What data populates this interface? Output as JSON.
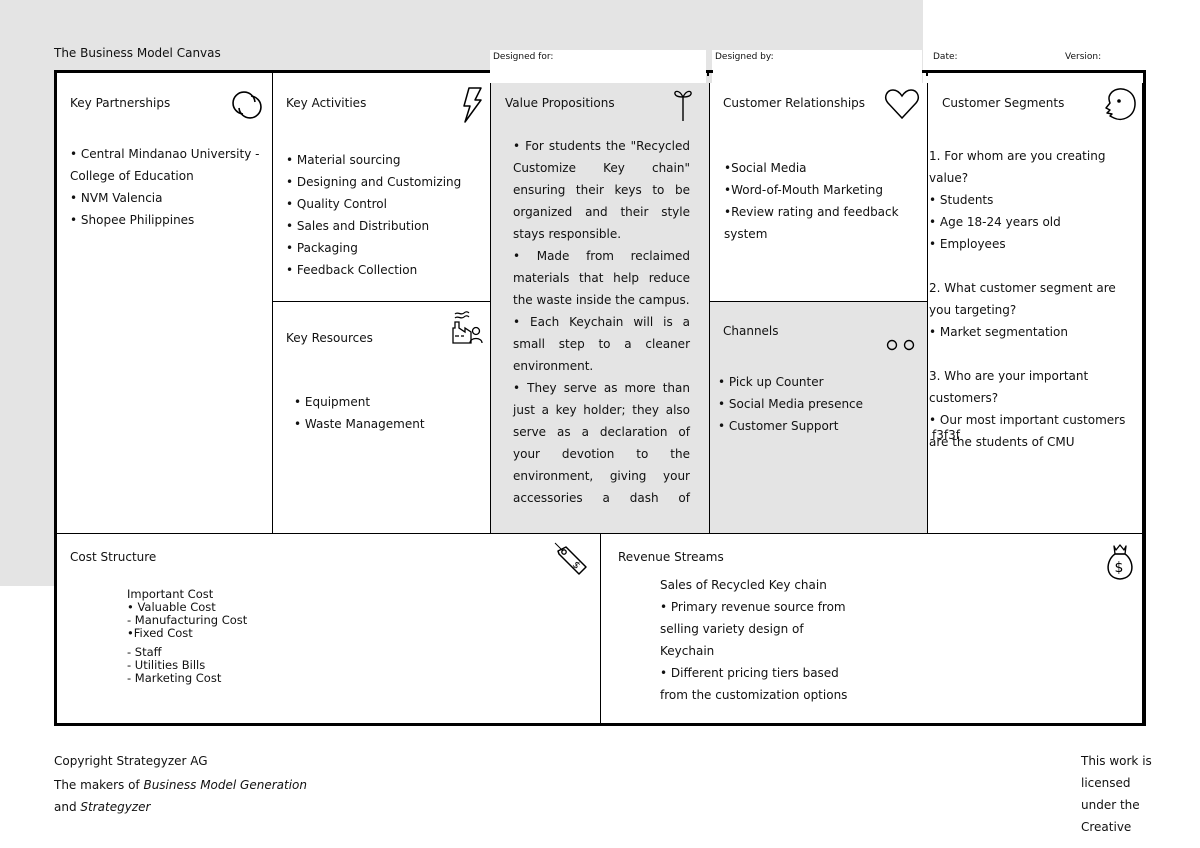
{
  "header": {
    "title": "The Business Model Canvas",
    "designed_for_label": "Designed for:",
    "designed_by_label": "Designed by:",
    "date_label": "Date:",
    "version_label": "Version:"
  },
  "blocks": {
    "key_partnerships": {
      "title": "Key Partnerships",
      "icon": "link-icon",
      "items": [
        "• Central Mindanao University -",
        "College of Education",
        "• NVM Valencia",
        "• Shopee Philippines"
      ]
    },
    "key_activities": {
      "title": "Key Activities",
      "icon": "lightning-icon",
      "items": [
        "• Material sourcing",
        "• Designing and Customizing",
        "• Quality Control",
        "• Sales and Distribution",
        "• Packaging",
        "• Feedback Collection"
      ]
    },
    "key_resources": {
      "title": "Key Resources",
      "icon": "factory-worker-icon",
      "items": [
        "• Equipment",
        "• Waste Management"
      ]
    },
    "value_propositions": {
      "title": "Value Propositions",
      "icon": "gift-icon",
      "text": "• For students the \"Recycled Customize Key chain\" ensuring their keys to be organized and their style stays responsible. • Made from reclaimed materials that help reduce the waste inside the campus. • Each Keychain will is a small step to a cleaner environment. • They serve as more than just a key holder; they also serve as a declaration of your devotion to the environment, giving your accessories a dash of",
      "paragraphs": [
        "• For students the \"Recycled Customize Key chain\" ensuring their keys to be organized and their style stays responsible.",
        "• Made from reclaimed materials that help reduce the waste inside the campus.",
        "• Each Keychain will is a small step to a cleaner environment.",
        "• They serve as more than just a key holder; they also serve as a declaration of your devotion to the environment, giving your accessories a dash of"
      ]
    },
    "customer_relationships": {
      "title": "Customer Relationships",
      "icon": "heart-icon",
      "items": [
        "•Social Media",
        "•Word-of-Mouth Marketing",
        "•Review rating and feedback",
        "system"
      ]
    },
    "channels": {
      "title": "Channels",
      "icon": "delivery-truck-icon",
      "items": [
        "• Pick up Counter",
        "• Social Media presence",
        "• Customer Support"
      ]
    },
    "customer_segments": {
      "title": "Customer Segments",
      "icon": "face-icon",
      "lines": [
        "1.  For whom are you creating",
        "value?",
        "• Students",
        "• Age 18-24 years old",
        "• Employees",
        "",
        "2. What customer segment are",
        "you targeting?",
        "• Market segmentation",
        "",
        "3. Who are your important",
        "customers?",
        "• Our most important customers",
        "are the students of CMU"
      ],
      "overlay_text": "f3f3f"
    },
    "cost_structure": {
      "title": "Cost Structure",
      "icon": "price-tag-icon",
      "lines_a": [
        "Important Cost",
        "• Valuable Cost",
        "- Manufacturing Cost",
        "•Fixed Cost"
      ],
      "lines_b": [
        "- Staff",
        "- Utilities Bills",
        "- Marketing Cost"
      ]
    },
    "revenue_streams": {
      "title": "Revenue Streams",
      "icon": "money-bag-icon",
      "lines": [
        "Sales of Recycled Key chain",
        "• Primary revenue source from",
        "selling variety design of",
        "Keychain",
        "• Different pricing tiers based",
        "from the customization options"
      ]
    }
  },
  "footer": {
    "copyright": "Copyright Strategyzer AG",
    "makers_prefix": "The makers of ",
    "makers_italic": "Business Model Generation",
    "and_prefix": "and ",
    "and_italic": "Strategyzer",
    "license_lines": [
      "This work is",
      "licensed",
      "under the",
      "Creative"
    ]
  }
}
